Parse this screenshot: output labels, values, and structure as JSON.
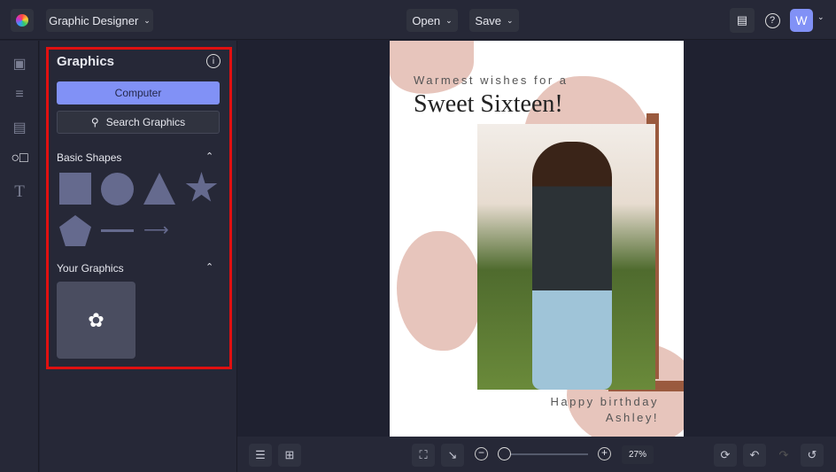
{
  "header": {
    "app_name": "Graphic Designer",
    "open_label": "Open",
    "save_label": "Save",
    "avatar_letter": "W"
  },
  "panel": {
    "title": "Graphics",
    "computer_label": "Computer",
    "search_label": "Search Graphics",
    "basic_shapes_label": "Basic Shapes",
    "your_graphics_label": "Your Graphics"
  },
  "canvas": {
    "line1": "Warmest wishes for a",
    "line2": "Sweet Sixteen!",
    "line3": "Happy birthday",
    "line4": "Ashley!"
  },
  "zoom": {
    "value": "27%",
    "fraction": 0.05
  },
  "colors": {
    "accent": "#8191f6",
    "highlight": "#e01010",
    "blob": "#e7c5bc"
  }
}
